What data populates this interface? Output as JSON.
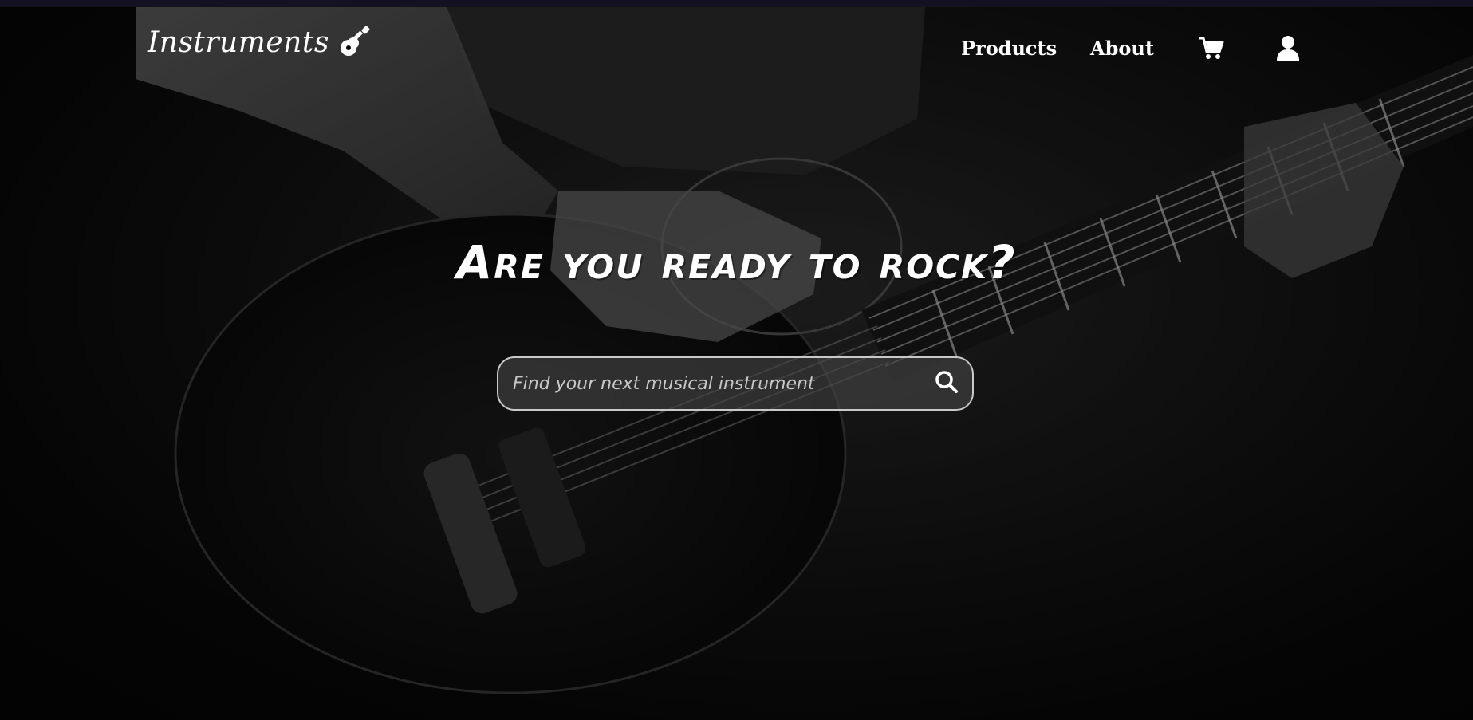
{
  "brand": {
    "title": "Instruments",
    "icon": "guitar-icon"
  },
  "nav": {
    "items": [
      {
        "label": "Products"
      },
      {
        "label": "About"
      }
    ],
    "cart_icon": "cart-icon",
    "user_icon": "user-icon"
  },
  "hero": {
    "headline": "Are you ready to rock?"
  },
  "search": {
    "placeholder": "Find your next musical instrument",
    "value": "",
    "icon": "search-icon"
  },
  "colors": {
    "background": "#0a0a0a",
    "text": "#ffffff",
    "top_strip": "#141222",
    "search_border": "#c9c9c9"
  }
}
